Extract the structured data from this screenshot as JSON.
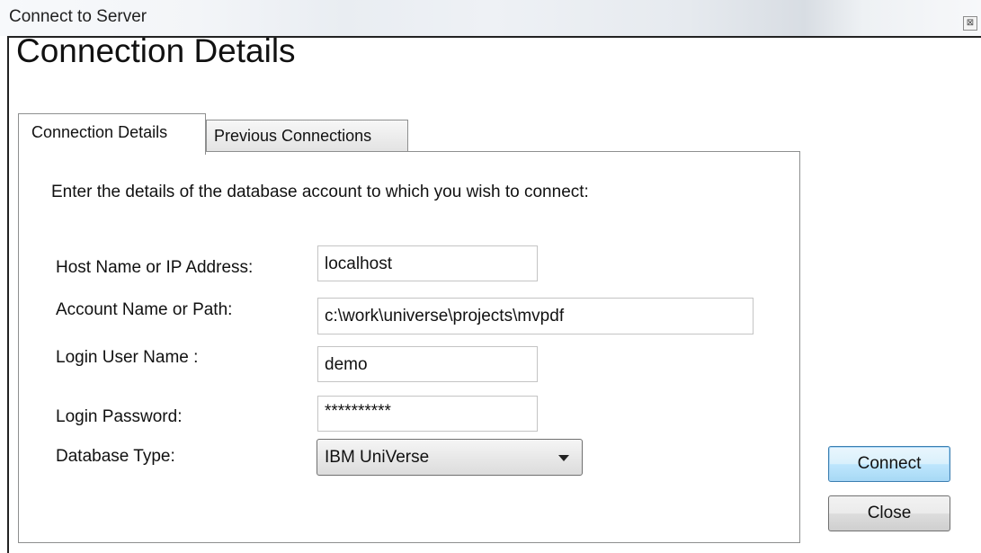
{
  "window": {
    "title": "Connect to Server",
    "close_glyph": "⊠"
  },
  "heading": "Connection Details",
  "tabs": [
    {
      "label": "Connection Details",
      "active": true
    },
    {
      "label": "Previous Connections",
      "active": false
    }
  ],
  "form": {
    "instructions": "Enter the details of the database account to which you wish to connect:",
    "host": {
      "label": "Host Name or IP Address:",
      "value": "localhost"
    },
    "account": {
      "label": "Account Name or Path:",
      "value": "c:\\work\\universe\\projects\\mvpdf"
    },
    "user": {
      "label": "Login User Name :",
      "value": "demo"
    },
    "password": {
      "label": "Login Password:",
      "value": "**********"
    },
    "db_type": {
      "label": "Database Type:",
      "value": "IBM UniVerse"
    }
  },
  "buttons": {
    "connect": "Connect",
    "close": "Close"
  },
  "colors": {
    "default_button_border": "#3c7fb1",
    "default_button_fill": "#bee6fd"
  }
}
